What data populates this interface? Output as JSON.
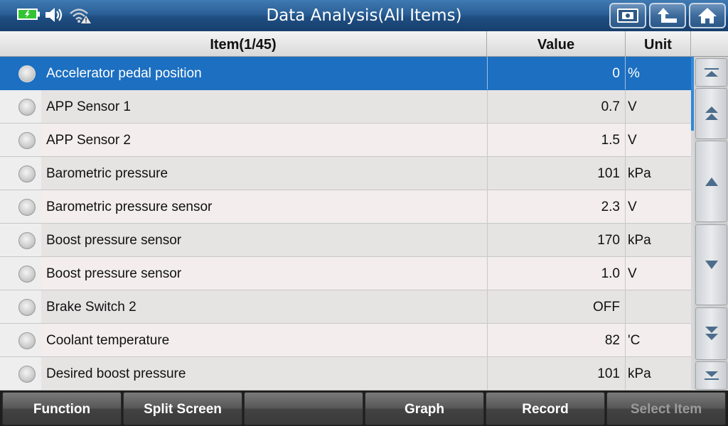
{
  "header": {
    "title": "Data Analysis(All Items)",
    "status_icons": [
      "battery-charging-icon",
      "speaker-icon",
      "wifi-warning-icon"
    ],
    "buttons": [
      "screenshot-icon",
      "back-arrow-icon",
      "home-icon"
    ]
  },
  "table": {
    "columns": {
      "item": "Item(1/45)",
      "value": "Value",
      "unit": "Unit"
    },
    "rows": [
      {
        "name": "Accelerator pedal position",
        "value": "0",
        "unit": "%",
        "selected": true
      },
      {
        "name": "APP Sensor 1",
        "value": "0.7",
        "unit": "V"
      },
      {
        "name": "APP Sensor 2",
        "value": "1.5",
        "unit": "V"
      },
      {
        "name": "Barometric pressure",
        "value": "101",
        "unit": "kPa"
      },
      {
        "name": "Barometric pressure sensor",
        "value": "2.3",
        "unit": "V"
      },
      {
        "name": "Boost pressure sensor",
        "value": "170",
        "unit": "kPa"
      },
      {
        "name": "Boost pressure sensor",
        "value": "1.0",
        "unit": "V"
      },
      {
        "name": "Brake Switch 2",
        "value": "OFF",
        "unit": ""
      },
      {
        "name": "Coolant temperature",
        "value": "82",
        "unit": "'C"
      },
      {
        "name": "Desired boost pressure",
        "value": "101",
        "unit": "kPa"
      }
    ]
  },
  "scroll_buttons": [
    "scroll-top-icon",
    "page-up-icon",
    "line-up-icon",
    "line-down-icon",
    "page-down-icon",
    "scroll-bottom-icon"
  ],
  "footer": {
    "buttons": [
      {
        "label": "Function",
        "enabled": true
      },
      {
        "label": "Split Screen",
        "enabled": true
      },
      {
        "label": "",
        "enabled": true
      },
      {
        "label": "Graph",
        "enabled": true
      },
      {
        "label": "Record",
        "enabled": true
      },
      {
        "label": "Select Item",
        "enabled": false
      }
    ]
  },
  "colors": {
    "title_bar": "#2a5f96",
    "selected_row": "#1c6fc1",
    "battery_green": "#33c433",
    "scroll_thumb": "#2f89d8"
  }
}
